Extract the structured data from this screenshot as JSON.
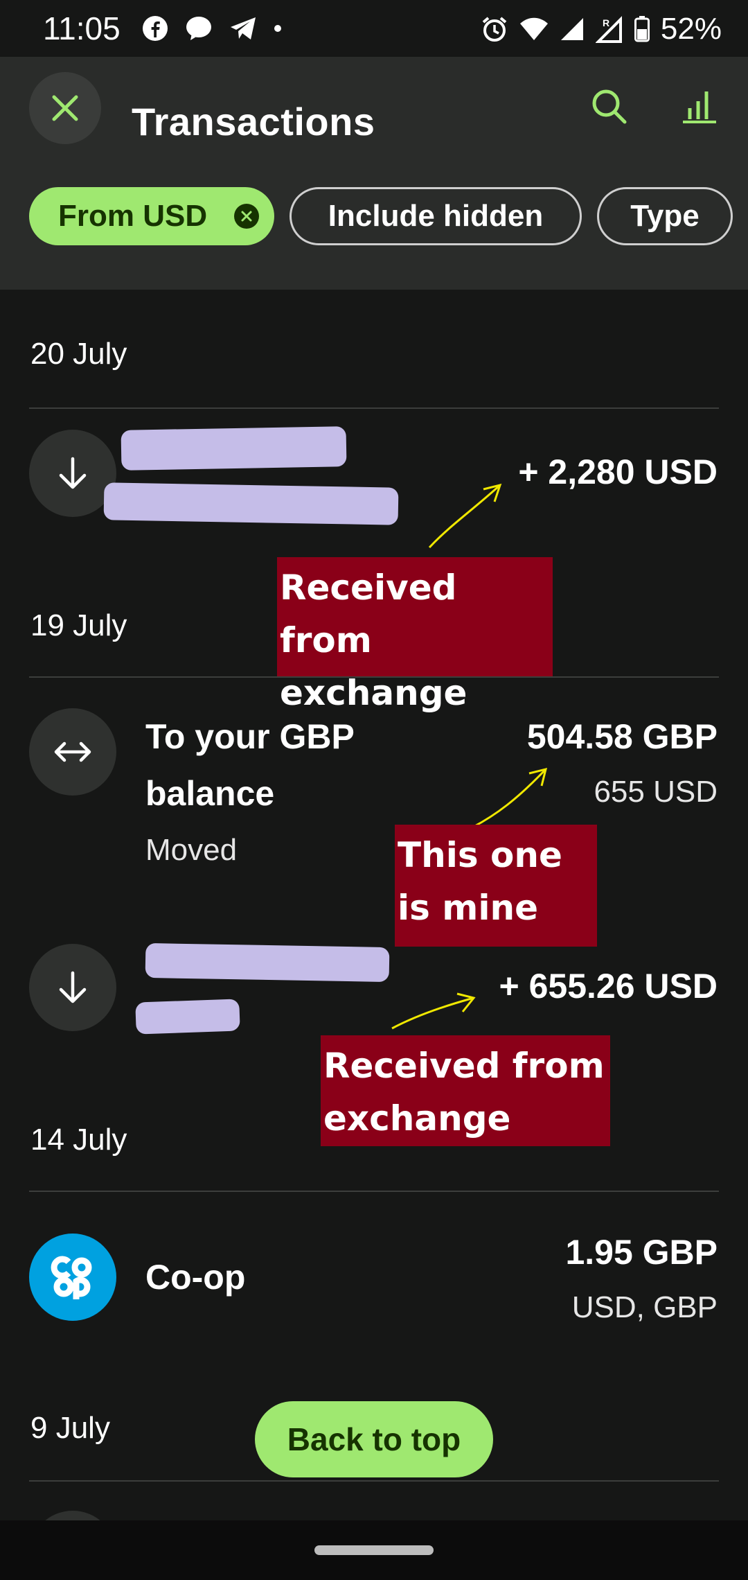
{
  "status_bar": {
    "time": "11:05",
    "battery": "52%",
    "left_icons": [
      "facebook-icon",
      "messenger-icon",
      "telegram-icon",
      "dot-icon"
    ],
    "right_icons": [
      "alarm-icon",
      "wifi-icon",
      "signal-icon",
      "signal-roaming-icon",
      "battery-icon"
    ]
  },
  "header": {
    "title": "Transactions",
    "filters": {
      "active": "From USD",
      "include_hidden": "Include hidden",
      "type": "Type"
    }
  },
  "groups": [
    {
      "date": "20 July",
      "transactions": [
        {
          "amount": "+ 2,280 USD",
          "icon": "arrow-down-icon"
        }
      ]
    },
    {
      "date": "19 July",
      "transactions": [
        {
          "title": "To your GBP balance",
          "subtitle": "Moved",
          "amount": "504.58 GBP",
          "amount_sub": "655 USD",
          "icon": "swap-arrows-icon"
        },
        {
          "amount": "+ 655.26 USD",
          "icon": "arrow-down-icon"
        }
      ]
    },
    {
      "date": "14 July",
      "transactions": [
        {
          "title": "Co-op",
          "amount": "1.95 GBP",
          "amount_sub": "USD, GBP",
          "icon": "coop-logo"
        }
      ]
    },
    {
      "date": "9 July",
      "transactions": []
    }
  ],
  "annotations": {
    "received_1": "Received from exchange",
    "mine": "This one is mine",
    "received_2": "Received from exchange"
  },
  "back_to_top": "Back to top",
  "colors": {
    "accent": "#9fe870",
    "accent_dark": "#163300",
    "annotation_bg": "#8a0018",
    "arrow_annotation": "#f0e800",
    "redaction": "#c5bde8",
    "coop_blue": "#00a1e0"
  }
}
